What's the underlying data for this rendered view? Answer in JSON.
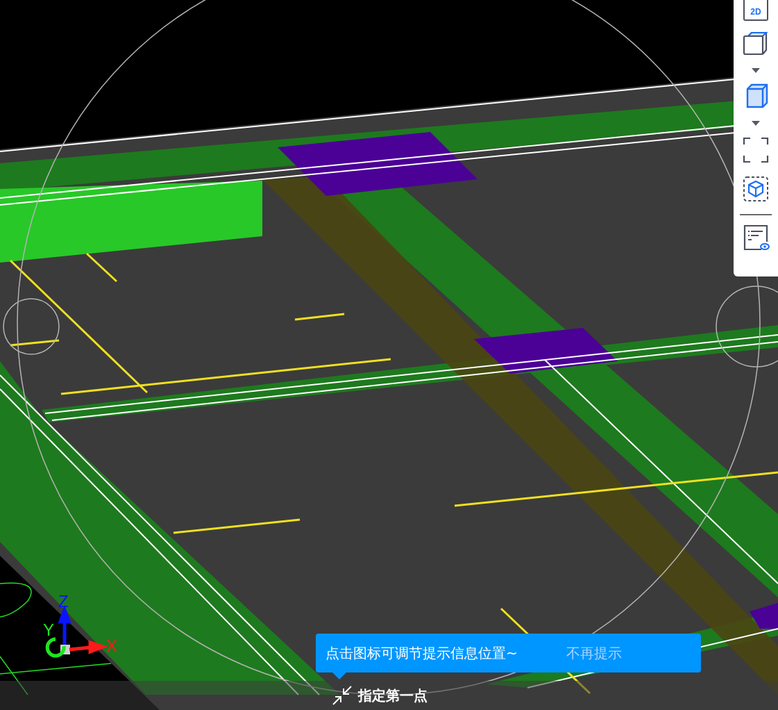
{
  "viewport": {
    "axes": [
      {
        "label": "Z",
        "color": "#0a14ff"
      },
      {
        "label": "Y",
        "color": "#1ee61e"
      },
      {
        "label": "X",
        "color": "#ff1a1a"
      }
    ]
  },
  "view_toolbar": {
    "buttons": [
      {
        "kind": "flat",
        "label": "2D"
      },
      {
        "kind": "cube-outline"
      },
      {
        "kind": "dropdown"
      },
      {
        "kind": "cube-filled"
      },
      {
        "kind": "dropdown"
      },
      {
        "kind": "frame"
      },
      {
        "kind": "cube-framed"
      },
      {
        "kind": "divider"
      },
      {
        "kind": "list-eye"
      }
    ]
  },
  "tip": {
    "message": "点击图标可调节提示信息位置~",
    "dismiss": "不再提示"
  },
  "command_prompt": "指定第一点"
}
